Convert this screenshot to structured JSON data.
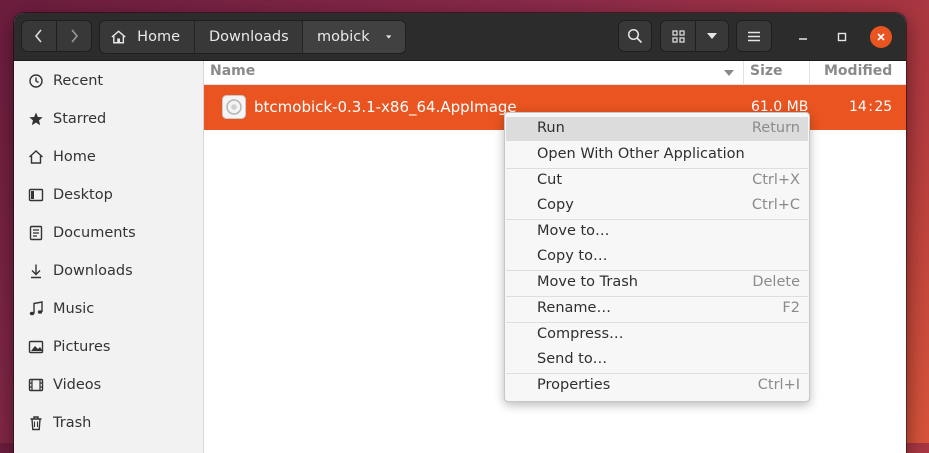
{
  "header": {
    "back_icon": "chevron-left-icon",
    "forward_icon": "chevron-right-icon",
    "breadcrumbs": [
      {
        "label": "Home",
        "icon": "home-icon"
      },
      {
        "label": "Downloads"
      },
      {
        "label": "mobick"
      }
    ],
    "breadcrumb_menu_icon": "chevron-down-icon",
    "search_icon": "search-icon",
    "grid_view_icon": "grid-view-icon",
    "view_options_icon": "chevron-down-icon",
    "menu_icon": "hamburger-icon",
    "window_controls": [
      "minimize-icon",
      "maximize-icon",
      "close-icon"
    ],
    "close_color": "#e95420"
  },
  "sidebar": {
    "items": [
      {
        "label": "Recent",
        "icon": "clock-icon"
      },
      {
        "label": "Starred",
        "icon": "star-icon"
      },
      {
        "label": "Home",
        "icon": "home-icon"
      },
      {
        "label": "Desktop",
        "icon": "desktop-icon"
      },
      {
        "label": "Documents",
        "icon": "document-icon"
      },
      {
        "label": "Downloads",
        "icon": "download-icon"
      },
      {
        "label": "Music",
        "icon": "music-icon"
      },
      {
        "label": "Pictures",
        "icon": "picture-icon"
      },
      {
        "label": "Videos",
        "icon": "video-icon"
      },
      {
        "label": "Trash",
        "icon": "trash-icon"
      }
    ]
  },
  "columns": {
    "name": "Name",
    "size": "Size",
    "modified": "Modified"
  },
  "files": [
    {
      "name": "btcmobick-0.3.1-x86_64.AppImage",
      "size": "61.0 MB",
      "modified": "14 : 25",
      "icon": "appimage-icon",
      "selected": true
    }
  ],
  "selection_color": "#e95420",
  "context_menu": {
    "items": [
      {
        "label": "Run",
        "accel": "Return",
        "highlighted": true
      },
      {
        "label": "Open With Other Application",
        "accel": ""
      },
      {
        "label": "Cut",
        "accel": "Ctrl+X"
      },
      {
        "label": "Copy",
        "accel": "Ctrl+C"
      },
      {
        "label": "Move to…",
        "accel": ""
      },
      {
        "label": "Copy to…",
        "accel": ""
      },
      {
        "label": "Move to Trash",
        "accel": "Delete"
      },
      {
        "label": "Rename…",
        "accel": "F2"
      },
      {
        "label": "Compress…",
        "accel": ""
      },
      {
        "label": "Send to…",
        "accel": ""
      },
      {
        "label": "Properties",
        "accel": "Ctrl+I"
      }
    ]
  }
}
